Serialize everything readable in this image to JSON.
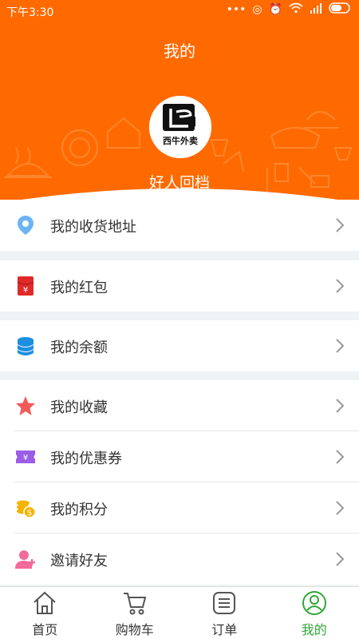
{
  "status_bar": {
    "time": "下午3:30"
  },
  "page_title": "我的",
  "profile": {
    "logo_text": "西牛外卖",
    "username": "好人回档"
  },
  "menu": {
    "address": "我的收货地址",
    "red_packet": "我的红包",
    "balance": "我的余额",
    "favorites": "我的收藏",
    "coupons": "我的优惠券",
    "points": "我的积分",
    "invite": "邀请好友"
  },
  "tabs": {
    "home": "首页",
    "cart": "购物车",
    "orders": "订单",
    "mine": "我的"
  },
  "colors": {
    "header": "#ff6a00",
    "active_tab": "#2ea836"
  }
}
